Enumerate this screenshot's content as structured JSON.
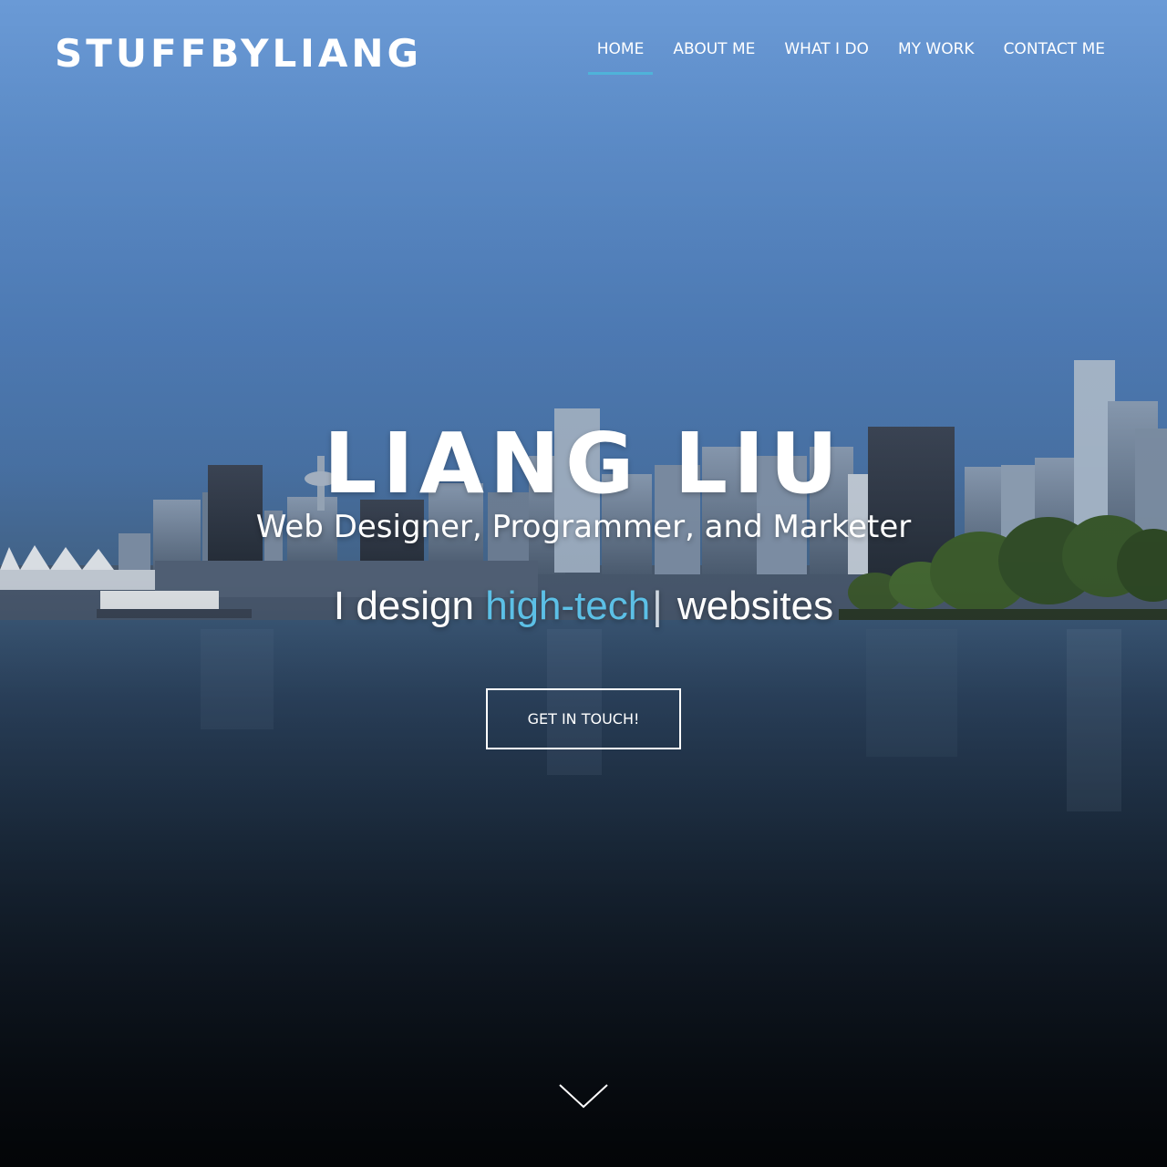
{
  "header": {
    "brand": "STUFFBYLIANG",
    "nav": [
      {
        "label": "HOME",
        "active": true
      },
      {
        "label": "ABOUT ME",
        "active": false
      },
      {
        "label": "WHAT I DO",
        "active": false
      },
      {
        "label": "MY WORK",
        "active": false
      },
      {
        "label": "CONTACT ME",
        "active": false
      }
    ]
  },
  "hero": {
    "name": "LIANG LIU",
    "subtitle": "Web Designer, Programmer, and Marketer",
    "tagline": {
      "prefix": "I design ",
      "highlight": "high-tech",
      "cursor": "|",
      "suffix": " websites"
    },
    "cta_label": "GET IN TOUCH!",
    "scroll_icon": "chevron-down-icon"
  },
  "colors": {
    "accent": "#4fb3d9",
    "highlight_text": "#5cc0e6",
    "text": "#ffffff"
  }
}
